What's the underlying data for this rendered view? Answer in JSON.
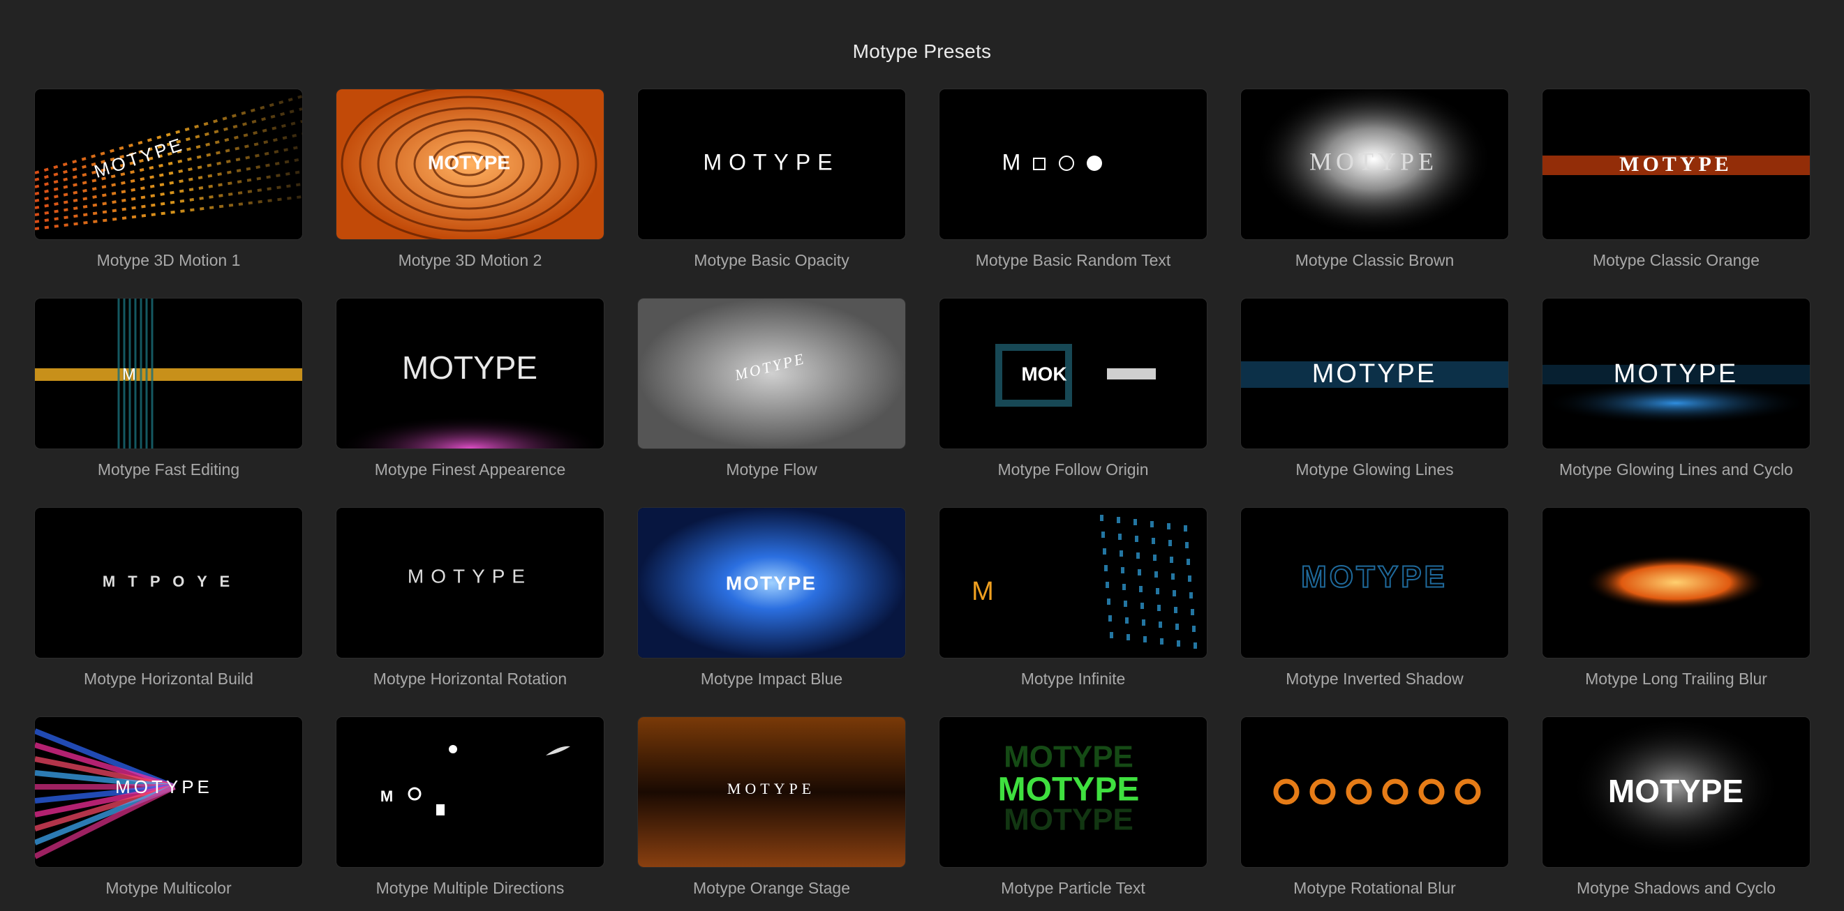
{
  "window": {
    "title": "Motype Presets"
  },
  "thumb_word": "MOTYPE",
  "presets": [
    {
      "label": "Motype 3D Motion 1",
      "text": "MOTYPE"
    },
    {
      "label": "Motype 3D Motion 2",
      "text": "MOTYPE"
    },
    {
      "label": "Motype Basic Opacity",
      "text": "MOTYPE"
    },
    {
      "label": "Motype Basic Random Text",
      "text": "M"
    },
    {
      "label": "Motype Classic Brown",
      "text": "MOTYPE"
    },
    {
      "label": "Motype Classic Orange",
      "text": "MOTYPE"
    },
    {
      "label": "Motype Fast Editing",
      "text": "M"
    },
    {
      "label": "Motype Finest Appearence",
      "text": "MOTYPE"
    },
    {
      "label": "Motype Flow",
      "text": "MOTYPE"
    },
    {
      "label": "Motype Follow Origin",
      "text": "MOK"
    },
    {
      "label": "Motype Glowing Lines",
      "text": "MOTYPE"
    },
    {
      "label": "Motype Glowing Lines and Cyclo",
      "text": "MOTYPE"
    },
    {
      "label": "Motype Horizontal Build",
      "text": "M T P O Y E"
    },
    {
      "label": "Motype Horizontal Rotation",
      "text": "MOTYPE"
    },
    {
      "label": "Motype Impact Blue",
      "text": "MOTYPE"
    },
    {
      "label": "Motype Infinite",
      "text": "M"
    },
    {
      "label": "Motype Inverted Shadow",
      "text": "MOTYPE"
    },
    {
      "label": "Motype Long Trailing Blur",
      "text": ""
    },
    {
      "label": "Motype Multicolor",
      "text": "MOTYPE"
    },
    {
      "label": "Motype Multiple Directions",
      "text": "M"
    },
    {
      "label": "Motype Orange Stage",
      "text": "MOTYPE"
    },
    {
      "label": "Motype Particle Text",
      "text": "MOTYPE"
    },
    {
      "label": "Motype Rotational Blur",
      "text": ""
    },
    {
      "label": "Motype Shadows and Cyclo",
      "text": "MOTYPE"
    }
  ]
}
